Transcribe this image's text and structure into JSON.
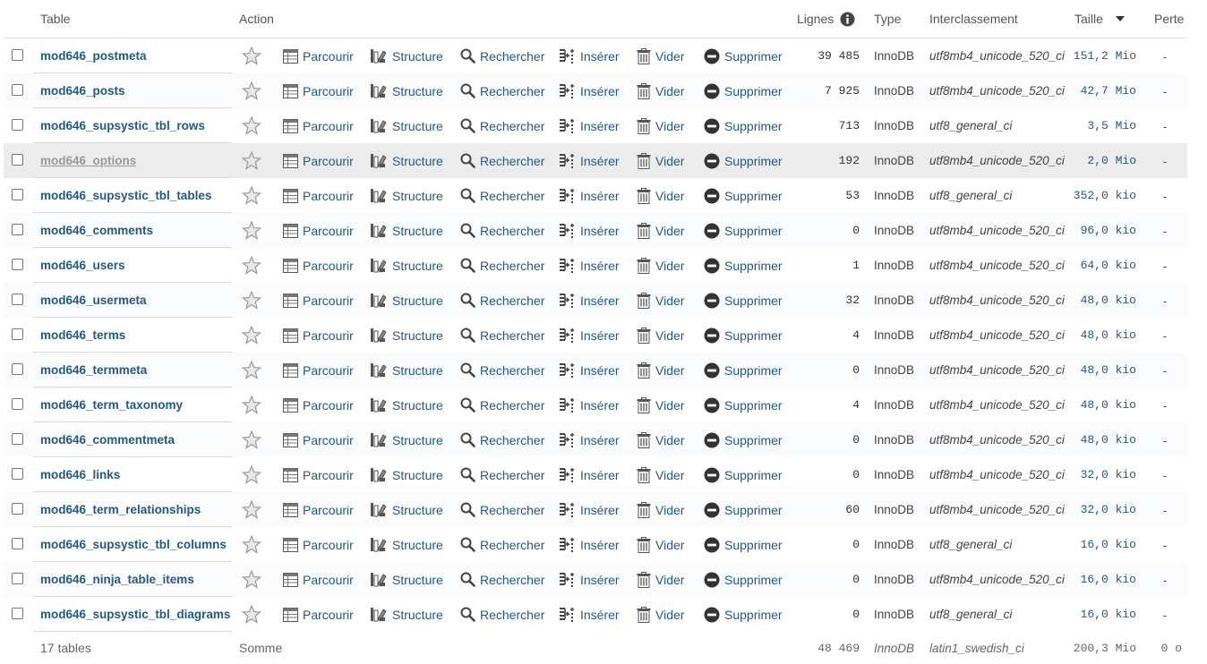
{
  "header": {
    "table": "Table",
    "action": "Action",
    "rows": "Lignes",
    "type": "Type",
    "collation": "Interclassement",
    "size": "Taille",
    "overhead": "Perte"
  },
  "actions": {
    "browse": "Parcourir",
    "structure": "Structure",
    "search": "Rechercher",
    "insert": "Insérer",
    "empty": "Vider",
    "drop": "Supprimer"
  },
  "tables": [
    {
      "name": "mod646_postmeta",
      "rows": "39 485",
      "engine": "InnoDB",
      "collation": "utf8mb4_unicode_520_ci",
      "size": "151,2 Mio",
      "overhead": "-"
    },
    {
      "name": "mod646_posts",
      "rows": "7 925",
      "engine": "InnoDB",
      "collation": "utf8mb4_unicode_520_ci",
      "size": "42,7 Mio",
      "overhead": "-"
    },
    {
      "name": "mod646_supsystic_tbl_rows",
      "rows": "713",
      "engine": "InnoDB",
      "collation": "utf8_general_ci",
      "size": "3,5 Mio",
      "overhead": "-"
    },
    {
      "name": "mod646_options",
      "rows": "192",
      "engine": "InnoDB",
      "collation": "utf8mb4_unicode_520_ci",
      "size": "2,0 Mio",
      "overhead": "-"
    },
    {
      "name": "mod646_supsystic_tbl_tables",
      "rows": "53",
      "engine": "InnoDB",
      "collation": "utf8_general_ci",
      "size": "352,0 kio",
      "overhead": "-"
    },
    {
      "name": "mod646_comments",
      "rows": "0",
      "engine": "InnoDB",
      "collation": "utf8mb4_unicode_520_ci",
      "size": "96,0 kio",
      "overhead": "-"
    },
    {
      "name": "mod646_users",
      "rows": "1",
      "engine": "InnoDB",
      "collation": "utf8mb4_unicode_520_ci",
      "size": "64,0 kio",
      "overhead": "-"
    },
    {
      "name": "mod646_usermeta",
      "rows": "32",
      "engine": "InnoDB",
      "collation": "utf8mb4_unicode_520_ci",
      "size": "48,0 kio",
      "overhead": "-"
    },
    {
      "name": "mod646_terms",
      "rows": "4",
      "engine": "InnoDB",
      "collation": "utf8mb4_unicode_520_ci",
      "size": "48,0 kio",
      "overhead": "-"
    },
    {
      "name": "mod646_termmeta",
      "rows": "0",
      "engine": "InnoDB",
      "collation": "utf8mb4_unicode_520_ci",
      "size": "48,0 kio",
      "overhead": "-"
    },
    {
      "name": "mod646_term_taxonomy",
      "rows": "4",
      "engine": "InnoDB",
      "collation": "utf8mb4_unicode_520_ci",
      "size": "48,0 kio",
      "overhead": "-"
    },
    {
      "name": "mod646_commentmeta",
      "rows": "0",
      "engine": "InnoDB",
      "collation": "utf8mb4_unicode_520_ci",
      "size": "48,0 kio",
      "overhead": "-"
    },
    {
      "name": "mod646_links",
      "rows": "0",
      "engine": "InnoDB",
      "collation": "utf8mb4_unicode_520_ci",
      "size": "32,0 kio",
      "overhead": "-"
    },
    {
      "name": "mod646_term_relationships",
      "rows": "60",
      "engine": "InnoDB",
      "collation": "utf8mb4_unicode_520_ci",
      "size": "32,0 kio",
      "overhead": "-"
    },
    {
      "name": "mod646_supsystic_tbl_columns",
      "rows": "0",
      "engine": "InnoDB",
      "collation": "utf8_general_ci",
      "size": "16,0 kio",
      "overhead": "-"
    },
    {
      "name": "mod646_ninja_table_items",
      "rows": "0",
      "engine": "InnoDB",
      "collation": "utf8mb4_unicode_520_ci",
      "size": "16,0 kio",
      "overhead": "-"
    },
    {
      "name": "mod646_supsystic_tbl_diagrams",
      "rows": "0",
      "engine": "InnoDB",
      "collation": "utf8_general_ci",
      "size": "16,0 kio",
      "overhead": "-"
    }
  ],
  "hovered_row": 3,
  "footer": {
    "count": "17 tables",
    "sum": "Somme",
    "rows": "48 469",
    "engine": "InnoDB",
    "collation": "latin1_swedish_ci",
    "size": "200,3 Mio",
    "overhead": "0 o"
  }
}
